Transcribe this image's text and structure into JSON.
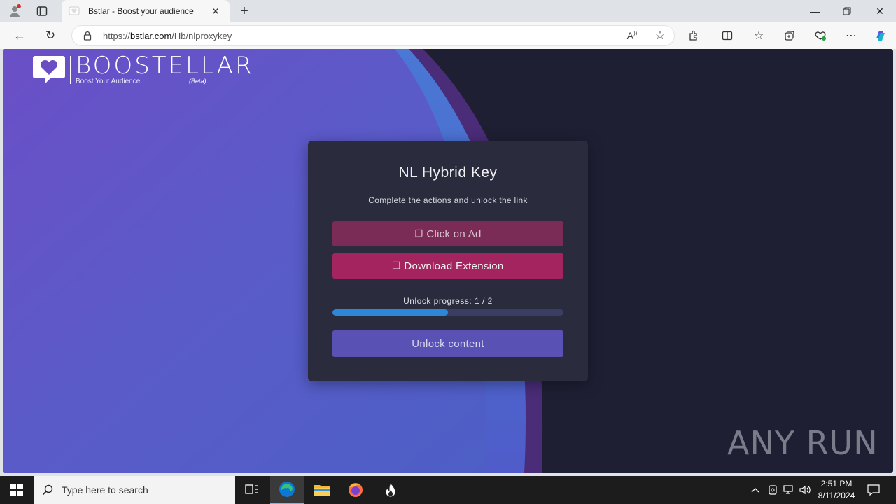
{
  "browser": {
    "tab_title": "Bstlar - Boost your audience",
    "url_prefix": "https://",
    "url_host": "bstlar.com",
    "url_path": "/Hb/nlproxykey"
  },
  "page": {
    "logo": {
      "brand": "BOOSTELLAR",
      "tagline": "Boost Your Audience",
      "beta": "(Beta)"
    },
    "card": {
      "title": "NL Hybrid Key",
      "subtitle": "Complete the actions and unlock the link",
      "button_ad": "Click on Ad",
      "button_extension": "Download Extension",
      "progress_label": "Unlock progress: 1 / 2",
      "progress_fraction": 0.5,
      "button_unlock": "Unlock content"
    },
    "watermark": "ANY RUN"
  },
  "taskbar": {
    "search_placeholder": "Type here to search",
    "time": "2:51 PM",
    "date": "8/11/2024"
  },
  "colors": {
    "accent_pink": "#a3245e",
    "accent_purple": "#5a51b5",
    "progress_blue": "#2e86d6"
  }
}
